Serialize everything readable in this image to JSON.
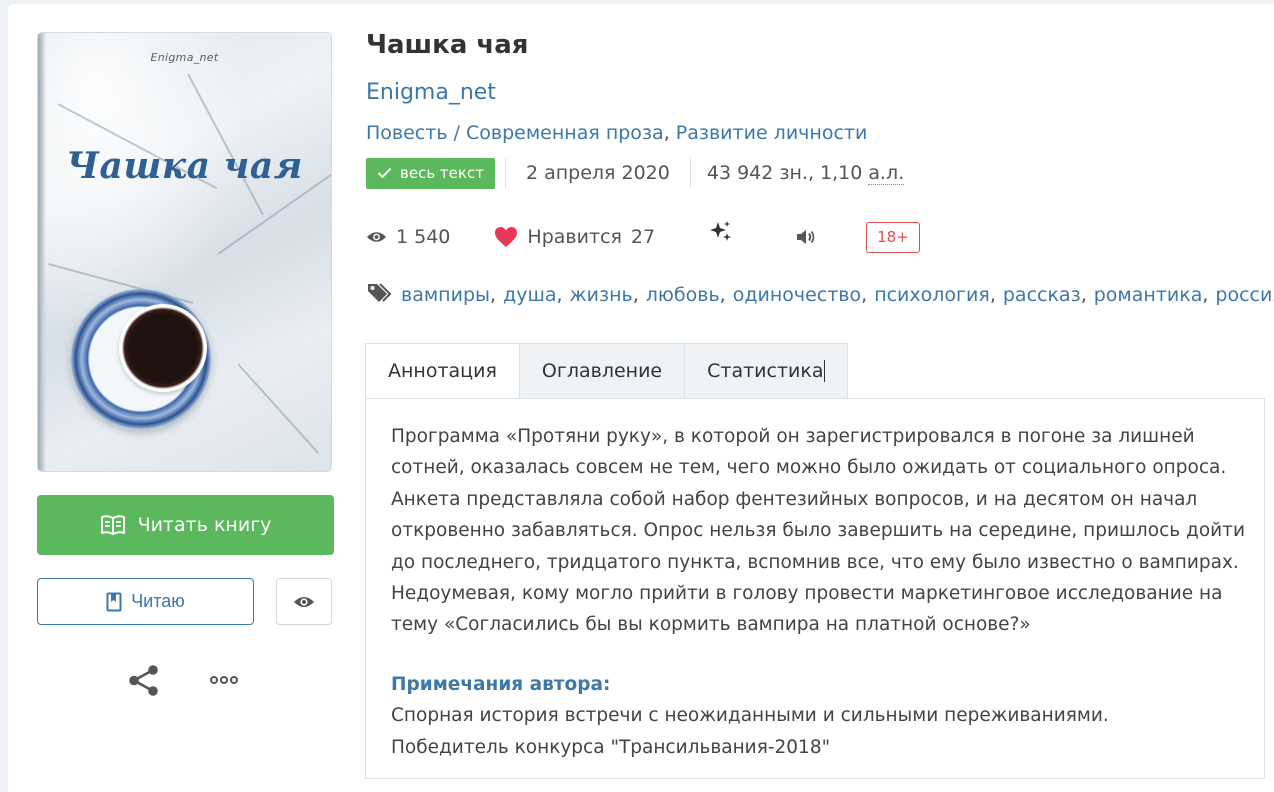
{
  "cover": {
    "author": "Enigma_net",
    "title": "Чашка чая"
  },
  "actions": {
    "read_book": "Читать книгу",
    "reading": "Читаю"
  },
  "book": {
    "title": "Чашка чая",
    "author": "Enigma_net",
    "genre_prefix": "Повесть",
    "genre_sep": " / ",
    "genres": [
      "Современная проза",
      "Развитие личности"
    ],
    "full_text_badge": "весь текст",
    "date": "2 апреля 2020",
    "size_prefix": "43 942 зн., 1,10 ",
    "size_unit": "а.л.",
    "views": "1 540",
    "likes_label": "Нравится",
    "likes": "27",
    "age_rating": "18+"
  },
  "tags": [
    "вампиры",
    "душа",
    "жизнь",
    "любовь",
    "одиночество",
    "психология",
    "рассказ",
    "романтика",
    "россия"
  ],
  "tabs": [
    "Аннотация",
    "Оглавление",
    "Статистика"
  ],
  "annotation": {
    "lines": [
      "Программа «Протяни руку», в которой он зарегистрировался в погоне за лишней",
      "сотней, оказалась совсем не тем, чего можно было ожидать от социального опроса.",
      "Анкета представляла собой набор фентезийных вопросов, и на десятом он начал",
      "откровенно забавляться. Опрос нельзя было завершить на середине, пришлось дойти",
      "до последнего, тридцатого пункта, вспомнив все, что ему было известно о вампирах.",
      "Недоумевая, кому могло прийти в голову провести маркетинговое исследование на",
      "тему «Согласились бы вы кормить вампира на платной основе?»"
    ],
    "notes_title": "Примечания автора:",
    "notes": [
      "Спорная история встречи с неожиданными и сильными переживаниями.",
      "Победитель конкурса \"Трансильвания-2018\""
    ]
  },
  "colors": {
    "accent_green": "#5cb85c",
    "link_blue": "#3c78a8",
    "heart_red": "#e8385a",
    "age_red": "#d9534f"
  }
}
